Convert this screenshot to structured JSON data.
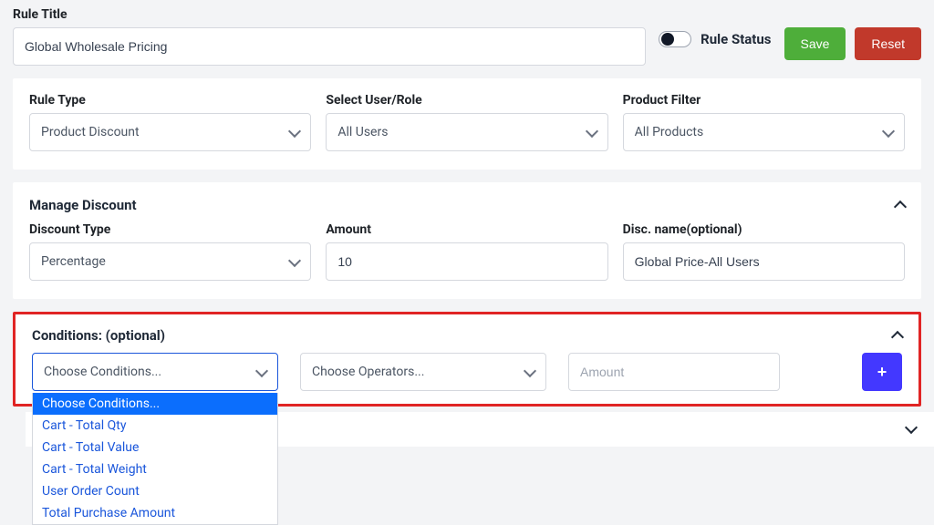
{
  "title_section": {
    "label": "Rule Title",
    "value": "Global Wholesale Pricing"
  },
  "status": {
    "label": "Rule Status",
    "on": false
  },
  "buttons": {
    "save": "Save",
    "reset": "Reset",
    "add": "+"
  },
  "row1": {
    "rule_type": {
      "label": "Rule Type",
      "value": "Product Discount"
    },
    "user_role": {
      "label": "Select User/Role",
      "value": "All Users"
    },
    "product_filter": {
      "label": "Product Filter",
      "value": "All Products"
    }
  },
  "manage_discount": {
    "title": "Manage Discount",
    "discount_type": {
      "label": "Discount Type",
      "value": "Percentage"
    },
    "amount": {
      "label": "Amount",
      "value": "10"
    },
    "disc_name": {
      "label": "Disc. name(optional)",
      "value": "Global Price-All Users"
    }
  },
  "conditions": {
    "title": "Conditions: (optional)",
    "condition_select": {
      "value": "Choose Conditions..."
    },
    "operator_select": {
      "value": "Choose Operators..."
    },
    "amount_placeholder": "Amount",
    "options": [
      "Choose Conditions...",
      "Cart - Total Qty",
      "Cart - Total Value",
      "Cart - Total Weight",
      "User Order Count",
      "Total Purchase Amount"
    ]
  }
}
